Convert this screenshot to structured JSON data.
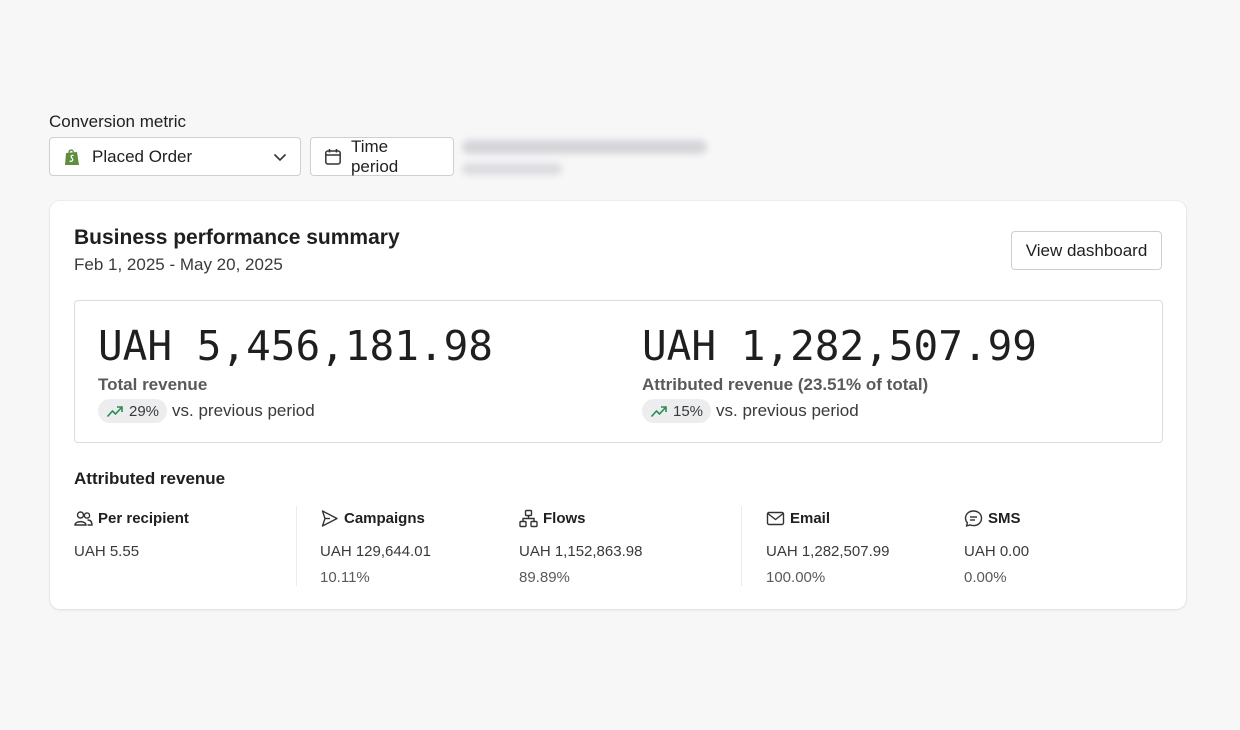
{
  "controls": {
    "conversion_metric_label": "Conversion metric",
    "metric_value": "Placed Order",
    "time_period_label": "Time period"
  },
  "card": {
    "title": "Business performance summary",
    "date_range": "Feb 1, 2025 - May 20, 2025",
    "view_dashboard_label": "View dashboard"
  },
  "summary": {
    "total": {
      "value": "UAH 5,456,181.98",
      "label": "Total revenue",
      "change": "29%",
      "comparison": "vs. previous period"
    },
    "attributed": {
      "value": "UAH 1,282,507.99",
      "label": "Attributed revenue (23.51% of total)",
      "change": "15%",
      "comparison": "vs. previous period"
    }
  },
  "attributed_revenue": {
    "title": "Attributed revenue",
    "columns": [
      {
        "label": "Per recipient",
        "icon": "users-icon",
        "value": "UAH 5.55",
        "percent": ""
      },
      {
        "label": "Campaigns",
        "icon": "send-icon",
        "value": "UAH 129,644.01",
        "percent": "10.11%"
      },
      {
        "label": "Flows",
        "icon": "flow-icon",
        "value": "UAH 1,152,863.98",
        "percent": "89.89%"
      },
      {
        "label": "Email",
        "icon": "mail-icon",
        "value": "UAH 1,282,507.99",
        "percent": "100.00%"
      },
      {
        "label": "SMS",
        "icon": "chat-icon",
        "value": "UAH 0.00",
        "percent": "0.00%"
      }
    ]
  },
  "colors": {
    "trend_green": "#2e8a57",
    "shopify_green": "#5e8e3e"
  }
}
